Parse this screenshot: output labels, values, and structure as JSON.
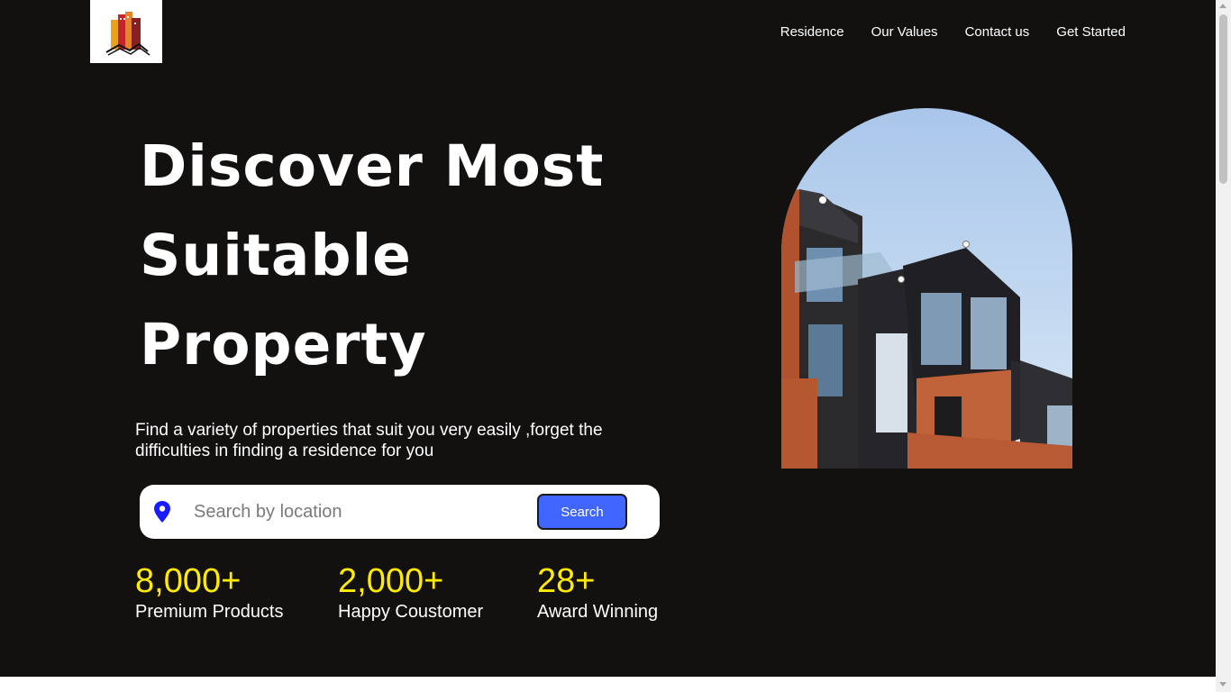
{
  "header": {
    "logo_icon": "buildings-logo-icon",
    "nav": [
      {
        "label": "Residence"
      },
      {
        "label": "Our Values"
      },
      {
        "label": "Contact us"
      },
      {
        "label": "Get Started"
      }
    ]
  },
  "hero": {
    "headline": [
      "Discover Most",
      "Suitable",
      "Property"
    ],
    "subtitle": "Find a variety of properties that suit you very easily ,forget the difficulties in finding a residence for you",
    "search": {
      "icon": "location-pin-icon",
      "placeholder": "Search by location",
      "value": "",
      "button_label": "Search"
    },
    "stats": [
      {
        "value": "8,000+",
        "label": "Premium Products"
      },
      {
        "value": "2,000+",
        "label": "Happy Coustomer"
      },
      {
        "value": "28+",
        "label": "Award Winning"
      }
    ]
  },
  "colors": {
    "background": "#131110",
    "accent": "#ffeb00",
    "button": "#4066ff",
    "text": "#ffffff",
    "pin": "#1a1aff"
  }
}
